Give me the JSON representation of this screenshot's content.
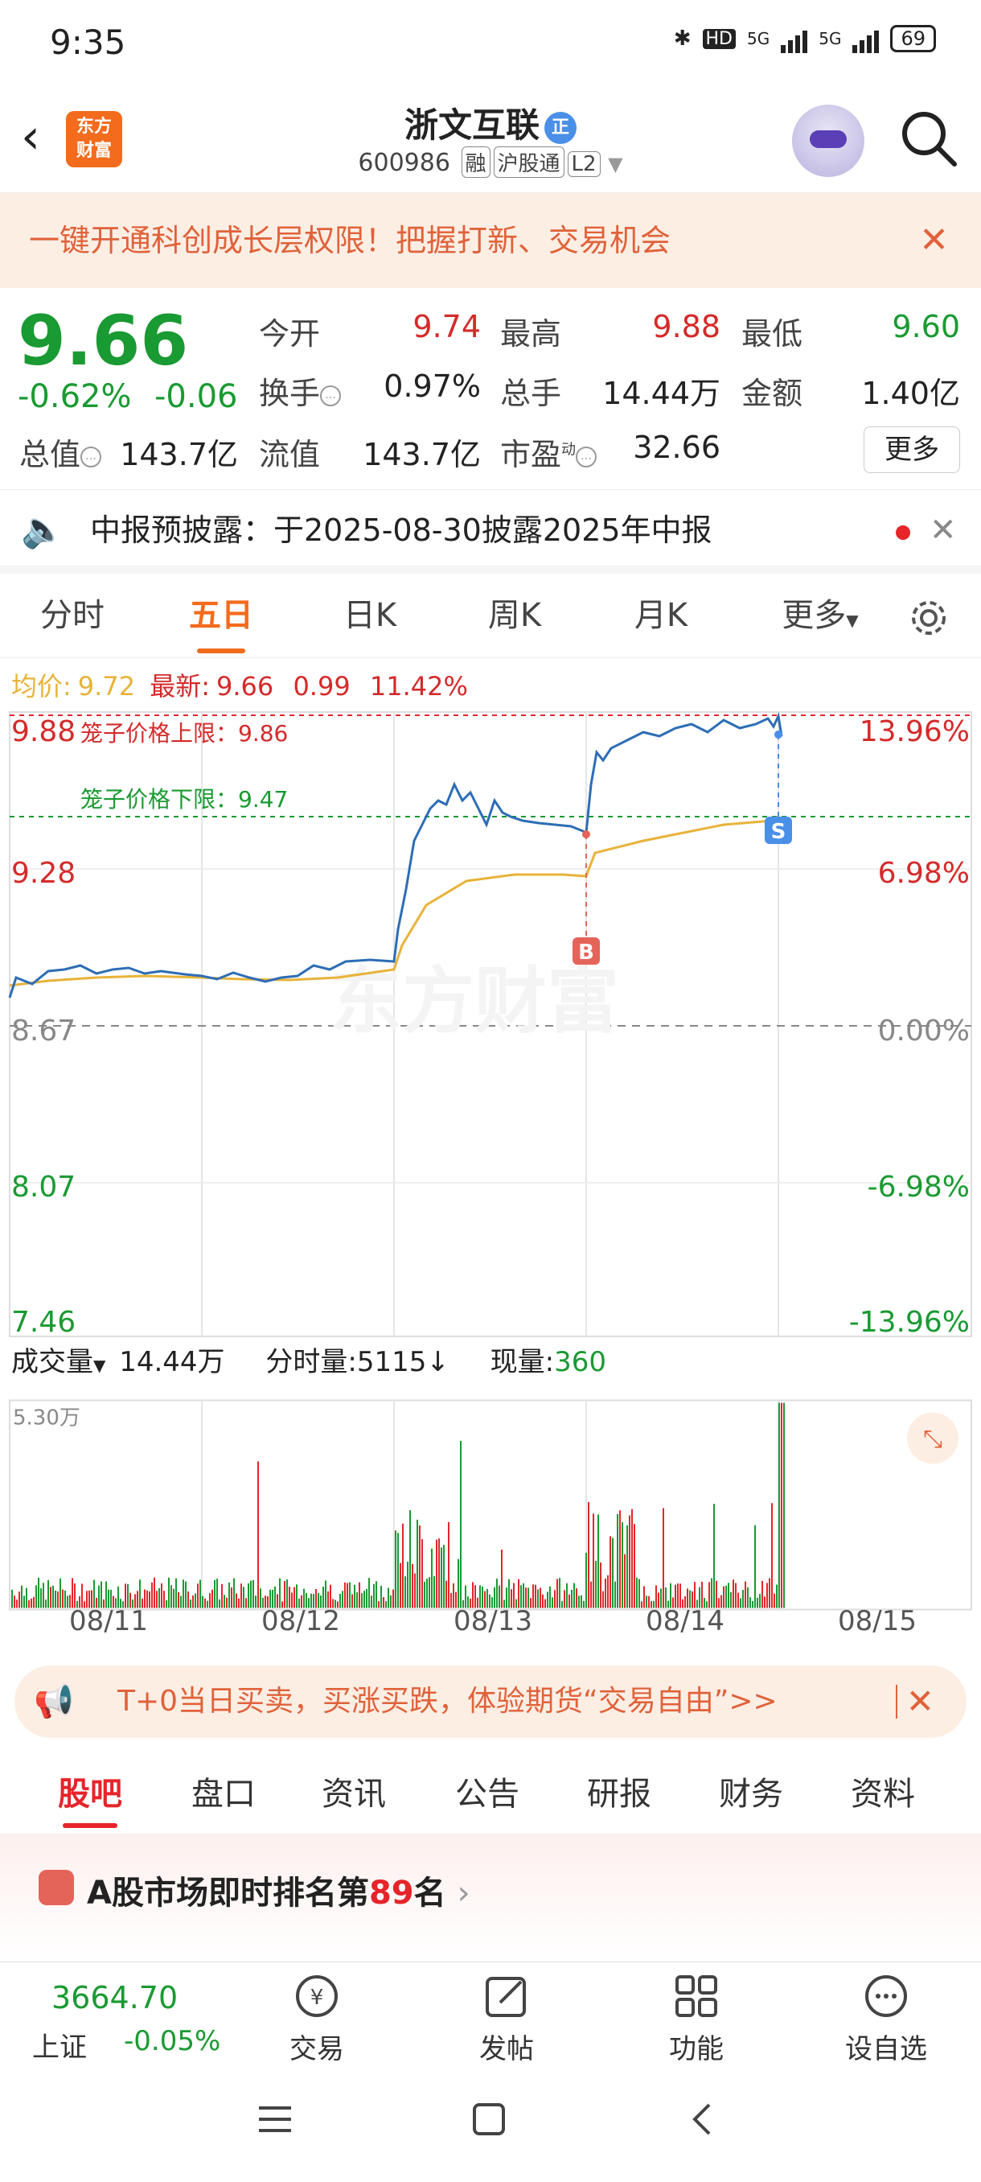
{
  "status": {
    "time": "9:35",
    "net1": "5G",
    "net2": "5G",
    "battery": "69",
    "hd": "HD"
  },
  "header": {
    "stock_name": "浙文互联",
    "badge": "正",
    "code": "600986",
    "tag1": "融",
    "tag2": "沪股通",
    "tag3": "L2",
    "logo_top": "东方",
    "logo_bottom": "财富"
  },
  "promo": {
    "text": "一键开通科创成长层权限！把握打新、交易机会"
  },
  "quote": {
    "price": "9.66",
    "pct": "-0.62%",
    "chg": "-0.06",
    "open_label": "今开",
    "open": "9.74",
    "high_label": "最高",
    "high": "9.88",
    "low_label": "最低",
    "low": "9.60",
    "turnover_label": "换手",
    "turnover": "0.97%",
    "volume_label": "总手",
    "volume": "14.44万",
    "amount_label": "金额",
    "amount": "1.40亿",
    "mktcap_label": "总值",
    "mktcap": "143.7亿",
    "float_label": "流值",
    "float": "143.7亿",
    "pe_label": "市盈",
    "pe_sup": "动",
    "pe": "32.66",
    "more": "更多"
  },
  "notice": {
    "text": "中报预披露：于2025-08-30披露2025年中报"
  },
  "tabs": [
    "分时",
    "五日",
    "日K",
    "周K",
    "月K",
    "更多"
  ],
  "avg_line": {
    "avg_label": "均价:",
    "avg": "9.72",
    "latest_label": "最新:",
    "latest": "9.66",
    "chg": "0.99",
    "pct": "11.42%"
  },
  "chart": {
    "y_left": [
      "9.88",
      "9.28",
      "8.67",
      "8.07",
      "7.46"
    ],
    "y_right": [
      "13.96%",
      "6.98%",
      "0.00%",
      "-6.98%",
      "-13.96%"
    ],
    "upper_limit": "笼子价格上限：9.86",
    "lower_limit": "笼子价格下限：9.47",
    "buy_marker": "B",
    "sell_marker": "S",
    "watermark": "东方财富"
  },
  "chart_data": {
    "type": "line",
    "x": [
      "08/11",
      "08/12",
      "08/13",
      "08/14",
      "08/15"
    ],
    "ylim": [
      7.46,
      9.88
    ],
    "prev_close": 8.67,
    "series": []
  },
  "volume": {
    "label": "成交量",
    "total": "14.44万",
    "minute_label": "分时量:",
    "minute": "5115",
    "now_label": "现量:",
    "now": "360",
    "ymax": "5.30万"
  },
  "dates": [
    "08/11",
    "08/12",
    "08/13",
    "08/14",
    "08/15"
  ],
  "ad": {
    "text": "T+0当日买卖，买涨买跌，体验期货“交易自由”>>"
  },
  "subtabs": [
    "股吧",
    "盘口",
    "资讯",
    "公告",
    "研报",
    "财务",
    "资料"
  ],
  "rank": {
    "prefix": "A股市场即时排名第",
    "num": "89",
    "suffix": "名"
  },
  "bottom": {
    "index_value": "3664.70",
    "index_name": "上证",
    "index_chg": "-0.05%",
    "trade": "交易",
    "post": "发帖",
    "func": "功能",
    "watch": "设自选"
  },
  "colors": {
    "accent": "#f36b1c",
    "up": "#d42a2a",
    "down": "#1a9a32",
    "price_line": "#2d6db5",
    "avg_line": "#e8b33a"
  }
}
